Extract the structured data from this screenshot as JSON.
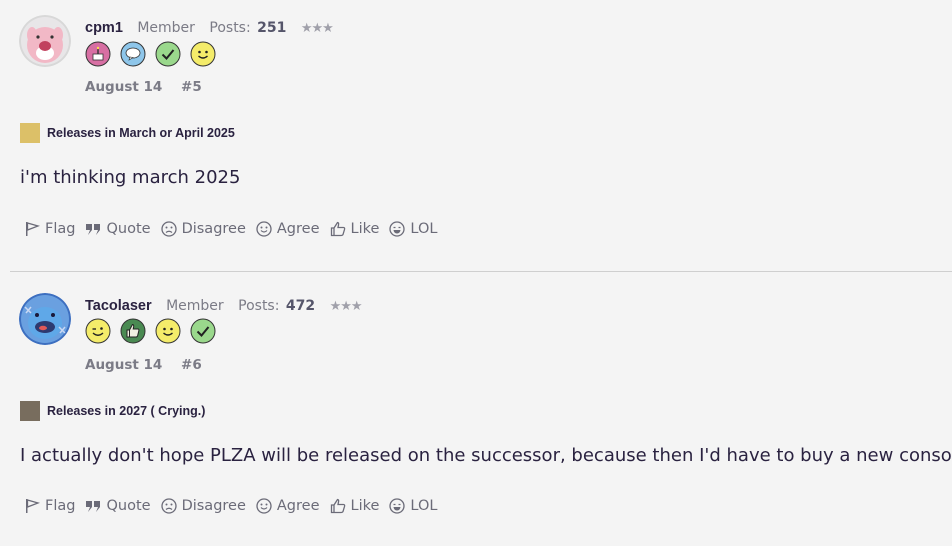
{
  "posts": [
    {
      "username": "cpm1",
      "role": "Member",
      "posts_label": "Posts:",
      "posts_count": "251",
      "stars": "★★★",
      "date": "August 14",
      "post_number": "#5",
      "poll_choice": "Releases in March or April 2025",
      "poll_color": "#dcc068",
      "body": "i'm thinking march 2025",
      "badges": [
        "cake-badge-icon",
        "speech-bubble-badge-icon",
        "checkmark-badge-icon",
        "smiley-badge-icon"
      ]
    },
    {
      "username": "Tacolaser",
      "role": "Member",
      "posts_label": "Posts:",
      "posts_count": "472",
      "stars": "★★★",
      "date": "August 14",
      "post_number": "#6",
      "poll_choice": "Releases in 2027 ( Crying.)",
      "poll_color": "#786d5e",
      "body": "I actually don't hope PLZA will be released on the successor, because then I'd have to buy a new console.",
      "badges": [
        "wink-badge-icon",
        "thumbs-up-badge-icon",
        "smiley-badge-icon",
        "checkmark-badge-icon"
      ]
    }
  ],
  "actions": {
    "flag": "Flag",
    "quote": "Quote",
    "disagree": "Disagree",
    "agree": "Agree",
    "like": "Like",
    "lol": "LOL"
  }
}
